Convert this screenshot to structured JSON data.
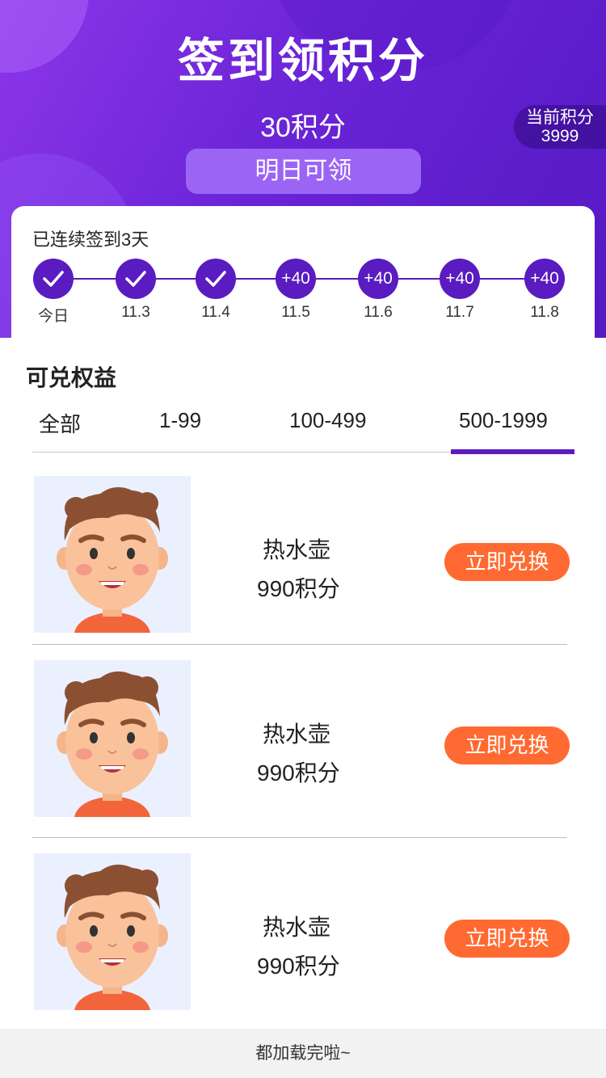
{
  "header": {
    "title": "签到领积分",
    "today_points": "30积分",
    "claim_button": "明日可领",
    "current_points_label": "当前积分",
    "current_points_value": "3999",
    "gradient": [
      "#8e35ea",
      "#5418c4"
    ]
  },
  "signin": {
    "streak_text": "已连续签到3天",
    "accent": "#5a1bc0",
    "days": [
      {
        "date": "今日",
        "status": "checked",
        "icon": "check-icon"
      },
      {
        "date": "11.3",
        "status": "checked",
        "icon": "check-icon"
      },
      {
        "date": "11.4",
        "status": "checked",
        "icon": "check-icon"
      },
      {
        "date": "11.5",
        "status": "reward",
        "reward": "+40"
      },
      {
        "date": "11.6",
        "status": "reward",
        "reward": "+40"
      },
      {
        "date": "11.7",
        "status": "reward",
        "reward": "+40"
      },
      {
        "date": "11.8",
        "status": "reward",
        "reward": "+40"
      }
    ]
  },
  "rewards": {
    "section_title": "可兑权益",
    "tabs": [
      {
        "label": "全部",
        "selected": false
      },
      {
        "label": "1-99",
        "selected": false
      },
      {
        "label": "100-499",
        "selected": false
      },
      {
        "label": "500-1999",
        "selected": true
      }
    ],
    "items": [
      {
        "name": "热水壶",
        "price": "990积分",
        "button": "立即兑换",
        "image": "avatar-boy-icon"
      },
      {
        "name": "热水壶",
        "price": "990积分",
        "button": "立即兑换",
        "image": "avatar-boy-icon"
      },
      {
        "name": "热水壶",
        "price": "990积分",
        "button": "立即兑换",
        "image": "avatar-boy-icon"
      }
    ],
    "button_color": "#ff6a32"
  },
  "footer": {
    "text": "都加载完啦~"
  }
}
